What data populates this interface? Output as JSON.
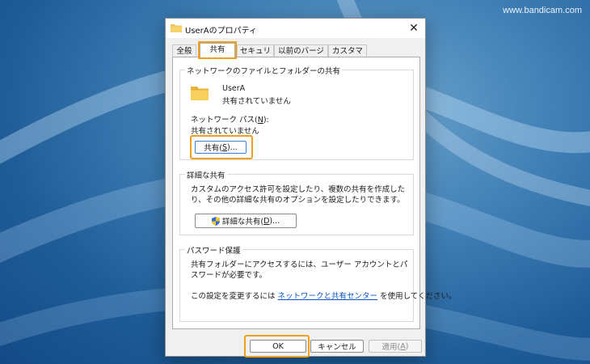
{
  "watermark": "www.bandicam.com",
  "dialog": {
    "title": "UserAのプロパティ",
    "close_glyph": "✕"
  },
  "tabs": [
    "全般",
    "共有",
    "セキュリティ",
    "以前のバージョン",
    "カスタマイズ"
  ],
  "active_tab": "共有",
  "network_share": {
    "legend": "ネットワークのファイルとフォルダーの共有",
    "folder_name": "UserA",
    "folder_status": "共有されていません",
    "path_label_pre": "ネットワーク パス(",
    "path_label_key": "N",
    "path_label_post": "):",
    "path_value": "共有されていません",
    "share_btn_pre": "共有(",
    "share_btn_key": "S",
    "share_btn_post": ")..."
  },
  "advanced_share": {
    "legend": "詳細な共有",
    "description": "カスタムのアクセス許可を設定したり、複数の共有を作成したり、その他の詳細な共有のオプションを設定したりできます。",
    "button_pre": "詳細な共有(",
    "button_key": "D",
    "button_post": ")..."
  },
  "password": {
    "legend": "パスワード保護",
    "description": "共有フォルダーにアクセスするには、ユーザー アカウントとパスワードが必要です。",
    "change_pre": "この設定を変更するには ",
    "change_link": "ネットワークと共有センター",
    "change_post": " を使用してください。"
  },
  "footer": {
    "ok": "OK",
    "cancel": "キャンセル",
    "apply_pre": "適用(",
    "apply_key": "A",
    "apply_post": ")"
  },
  "colors": {
    "highlight": "#f0a020",
    "link": "#0a54c4",
    "folder": "#f2c14e"
  },
  "icons": {
    "title": "folder-icon",
    "close": "close-icon",
    "folder": "folder-icon",
    "advanced": "shield-icon"
  }
}
